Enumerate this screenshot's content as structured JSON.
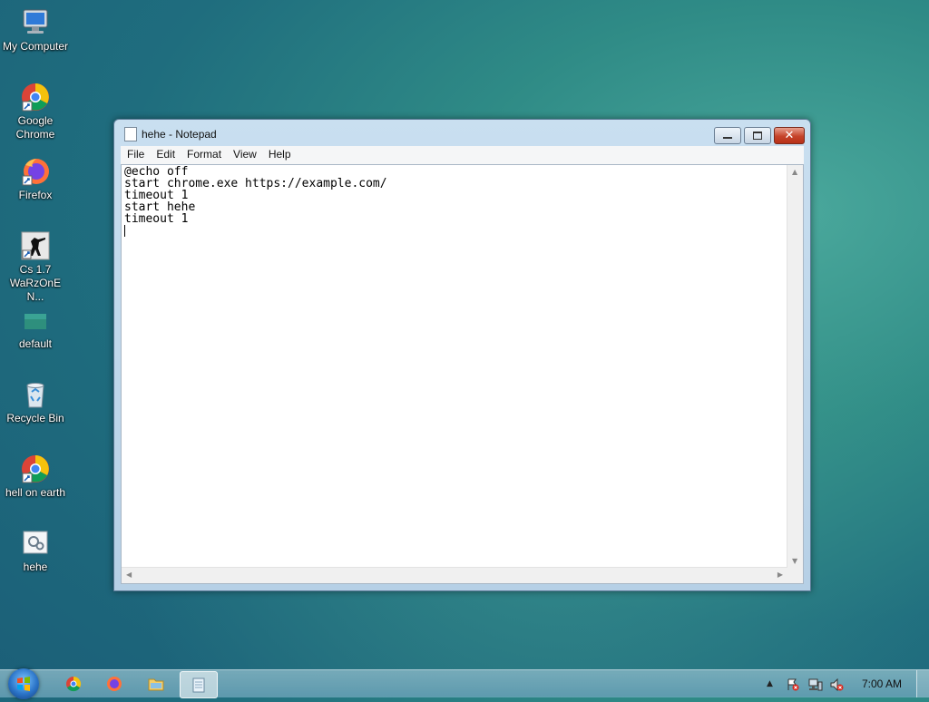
{
  "desktop": {
    "icons": [
      {
        "label": "My Computer",
        "icon": "computer-icon"
      },
      {
        "label": "Google Chrome",
        "icon": "chrome-icon"
      },
      {
        "label": "Firefox",
        "icon": "firefox-icon"
      },
      {
        "label": "Cs 1.7 WaRzOnE N...",
        "icon": "game-shortcut-icon"
      },
      {
        "label": "default",
        "icon": "image-file-icon"
      },
      {
        "label": "Recycle Bin",
        "icon": "recycle-bin-icon"
      },
      {
        "label": "hell on earth",
        "icon": "chrome-shortcut-icon"
      },
      {
        "label": "hehe",
        "icon": "batch-file-icon"
      }
    ]
  },
  "window": {
    "title": "hehe - Notepad",
    "menu": [
      "File",
      "Edit",
      "Format",
      "View",
      "Help"
    ],
    "content": "@echo off\nstart chrome.exe https://example.com/\ntimeout 1\nstart hehe\ntimeout 1"
  },
  "taskbar": {
    "clock": "7:00 AM",
    "pinned": [
      "chrome-icon",
      "firefox-icon",
      "folder-icon",
      "notepad-icon"
    ],
    "active": "notepad-icon"
  },
  "colors": {
    "accent": "#2b74c8",
    "close": "#c5432a"
  }
}
